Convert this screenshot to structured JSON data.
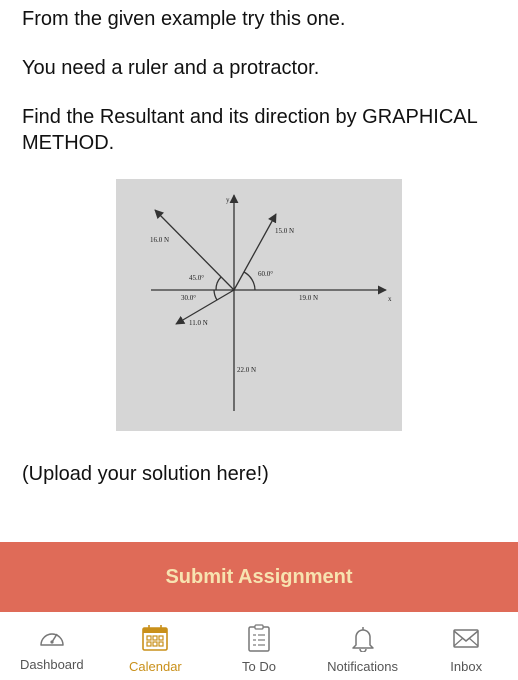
{
  "content": {
    "line1": "From the given example try this one.",
    "line2": "You need a ruler and a protractor.",
    "line3": "Find the Resultant and its direction by GRAPHICAL METHOD.",
    "upload_note": "(Upload your solution here!)"
  },
  "figure": {
    "axis_y": "y",
    "axis_x": "x",
    "forces": [
      {
        "magnitude": "16.0 N",
        "angle": "45.0°"
      },
      {
        "magnitude": "15.0 N",
        "angle": "60.0°"
      },
      {
        "magnitude": "19.0 N"
      },
      {
        "magnitude": "11.0 N",
        "angle": "30.0°"
      },
      {
        "magnitude": "22.0 N"
      }
    ]
  },
  "submit": {
    "label": "Submit Assignment"
  },
  "tabs": [
    {
      "label": "Dashboard",
      "icon": "dashboard-icon"
    },
    {
      "label": "Calendar",
      "icon": "calendar-icon",
      "active": true
    },
    {
      "label": "To Do",
      "icon": "todo-icon"
    },
    {
      "label": "Notifications",
      "icon": "bell-icon"
    },
    {
      "label": "Inbox",
      "icon": "inbox-icon"
    }
  ],
  "colors": {
    "submit_bg": "#df6b58",
    "submit_text": "#f7e3b0",
    "active_tab": "#c9901a",
    "inactive_tab": "#555555"
  }
}
